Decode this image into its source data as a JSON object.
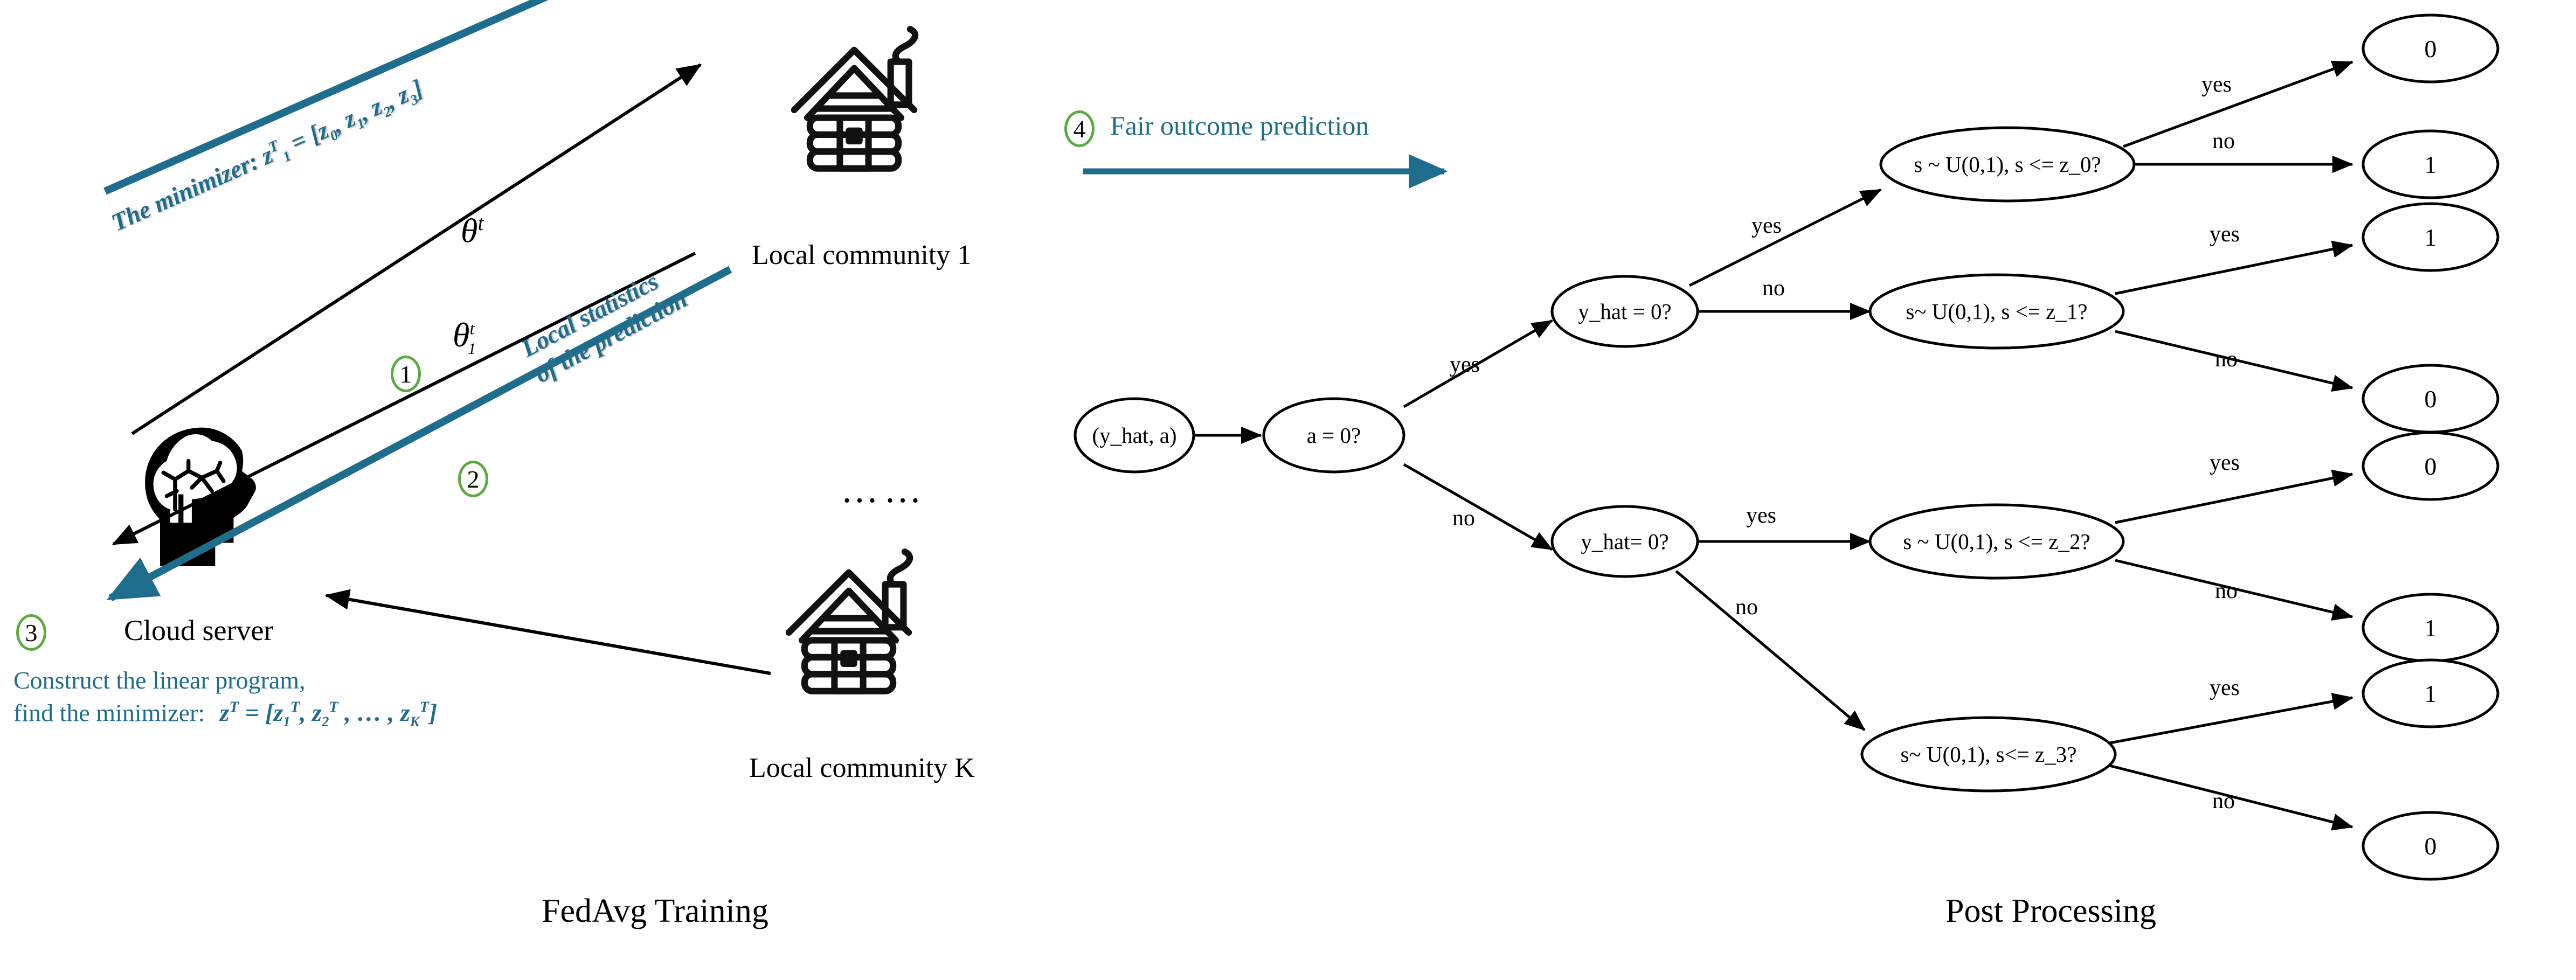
{
  "figure": {
    "left_caption": "FedAvg Training",
    "right_caption": "Post Processing"
  },
  "fedavg": {
    "cloud_server_label": "Cloud server",
    "step1_num": "1",
    "step2_num": "2",
    "step3_num": "3",
    "step1_symbol_base": "θ",
    "step1_symbol_sup": "t",
    "step1_symbol_sub": "1",
    "global_symbol_base": "θ",
    "global_symbol_sup": "t",
    "minimizer_arrow_label": "The minimizer: z₁ᵀ = [z₀, z₁, z₂, z₃]",
    "stats_arrow_label_line1": "Local statistics",
    "stats_arrow_label_line2": "of the prediction",
    "server_task_line1": "Construct the linear program,",
    "server_task_line2_prefix": "find the minimizer:",
    "server_task_line2_formula": "zᵀ = [z₁ᵀ, z₂ᵀ , … , z_Kᵀ]",
    "community_1_label": "Local community 1",
    "community_K_label": "Local community K",
    "ellipsis": "……",
    "accent_blue": "#1f6d8c",
    "accent_green": "#5aab3f"
  },
  "fair_step": {
    "number": "4",
    "label": "Fair outcome prediction"
  },
  "tree": {
    "nodes": [
      {
        "id": "root",
        "label": "(y_hat, a)"
      },
      {
        "id": "a0",
        "label": "a = 0?"
      },
      {
        "id": "yh_up",
        "label": "y_hat = 0?"
      },
      {
        "id": "yh_dn",
        "label": "y_hat= 0?"
      },
      {
        "id": "z0",
        "label": "s ~ U(0,1), s <= z_0?"
      },
      {
        "id": "z1",
        "label": "s~ U(0,1), s <= z_1?"
      },
      {
        "id": "z2",
        "label": "s ~ U(0,1), s <= z_2?"
      },
      {
        "id": "z3",
        "label": "s~ U(0,1), s<= z_3?"
      }
    ],
    "leaves": [
      {
        "id": "L1",
        "label": "0"
      },
      {
        "id": "L2",
        "label": "1"
      },
      {
        "id": "L3",
        "label": "1"
      },
      {
        "id": "L4",
        "label": "0"
      },
      {
        "id": "L5",
        "label": "0"
      },
      {
        "id": "L6",
        "label": "1"
      },
      {
        "id": "L7",
        "label": "1"
      },
      {
        "id": "L8",
        "label": "0"
      }
    ],
    "edge_labels": {
      "a0_yes": "yes",
      "a0_no": "no",
      "yhup_yes": "yes",
      "yhup_no": "no",
      "yhdn_yes": "yes",
      "yhdn_no": "no",
      "z0_yes": "yes",
      "z0_no": "no",
      "z1_yes": "yes",
      "z1_no": "no",
      "z2_yes": "yes",
      "z2_no": "no",
      "z3_yes": "yes",
      "z3_no": "no"
    }
  }
}
